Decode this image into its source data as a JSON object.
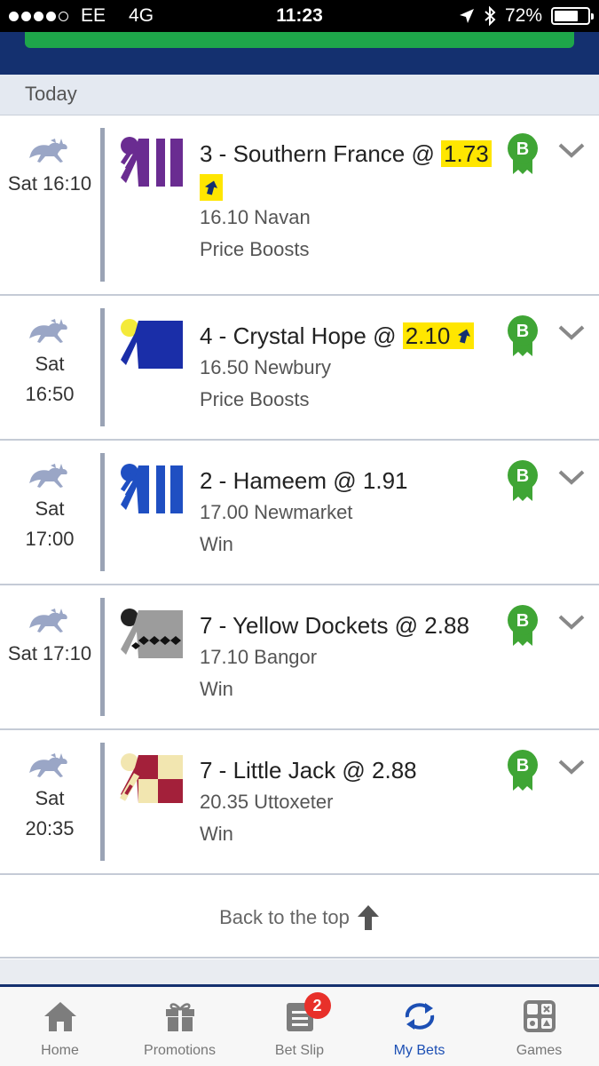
{
  "status": {
    "carrier": "EE",
    "network": "4G",
    "time": "11:23",
    "battery": "72%",
    "battery_level": 0.72
  },
  "day_header": "Today",
  "colors": {
    "navy": "#14306f",
    "green": "#1ea64a",
    "highlight": "#ffe600",
    "badge": "#3fa535",
    "active": "#1c4fb4"
  },
  "bets": [
    {
      "time_lines": [
        "Sat 16:10"
      ],
      "selection_prefix": "3 - Southern France @ ",
      "price": "1.73",
      "boosted": true,
      "race": "16.10 Navan",
      "market": "Price Boosts",
      "badge": "B",
      "silk": "purple"
    },
    {
      "time_lines": [
        "Sat",
        "16:50"
      ],
      "selection_prefix": "4 - Crystal Hope @ ",
      "price": "2.10",
      "boosted": true,
      "race": "16.50 Newbury",
      "market": "Price Boosts",
      "badge": "B",
      "silk": "navy"
    },
    {
      "time_lines": [
        "Sat",
        "17:00"
      ],
      "selection_prefix": "2 - Hameem @ ",
      "price": "1.91",
      "boosted": false,
      "race": "17.00 Newmarket",
      "market": "Win",
      "badge": "B",
      "silk": "blue"
    },
    {
      "time_lines": [
        "Sat 17:10"
      ],
      "selection_prefix": "7 - Yellow Dockets @ ",
      "price": "2.88",
      "boosted": false,
      "race": "17.10 Bangor",
      "market": "Win",
      "badge": "B",
      "silk": "grey"
    },
    {
      "time_lines": [
        "Sat",
        "20:35"
      ],
      "selection_prefix": "7 - Little Jack @ ",
      "price": "2.88",
      "boosted": false,
      "race": "20.35 Uttoxeter",
      "market": "Win",
      "badge": "B",
      "silk": "maroon"
    }
  ],
  "back_to_top": "Back to the top",
  "tabs": [
    {
      "label": "Home",
      "icon": "home-icon"
    },
    {
      "label": "Promotions",
      "icon": "gift-icon"
    },
    {
      "label": "Bet Slip",
      "icon": "betslip-icon",
      "count": "2"
    },
    {
      "label": "My Bets",
      "icon": "refresh-arrows-icon",
      "active": true
    },
    {
      "label": "Games",
      "icon": "games-icon"
    }
  ]
}
